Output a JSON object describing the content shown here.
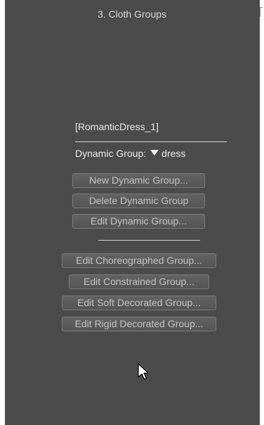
{
  "panel": {
    "title": "3. Cloth Groups",
    "figure_name": "[RomanticDress_1]",
    "dynamic_group": {
      "label": "Dynamic Group:",
      "value": "dress"
    },
    "buttons": {
      "new_dynamic": "New Dynamic Group...",
      "delete_dynamic": "Delete Dynamic Group",
      "edit_dynamic": "Edit Dynamic Group...",
      "edit_choreographed": "Edit Choreographed Group...",
      "edit_constrained": "Edit Constrained Group...",
      "edit_soft_decorated": "Edit Soft Decorated Group...",
      "edit_rigid_decorated": "Edit Rigid Decorated Group..."
    }
  },
  "icons": {
    "dropdown": "triangle-down-icon",
    "pointer": "mouse-pointer-icon"
  },
  "colors": {
    "panel_bg": "#4b4b4b",
    "button_bg": "#5c5c5c",
    "text": "#e8e8e8"
  }
}
